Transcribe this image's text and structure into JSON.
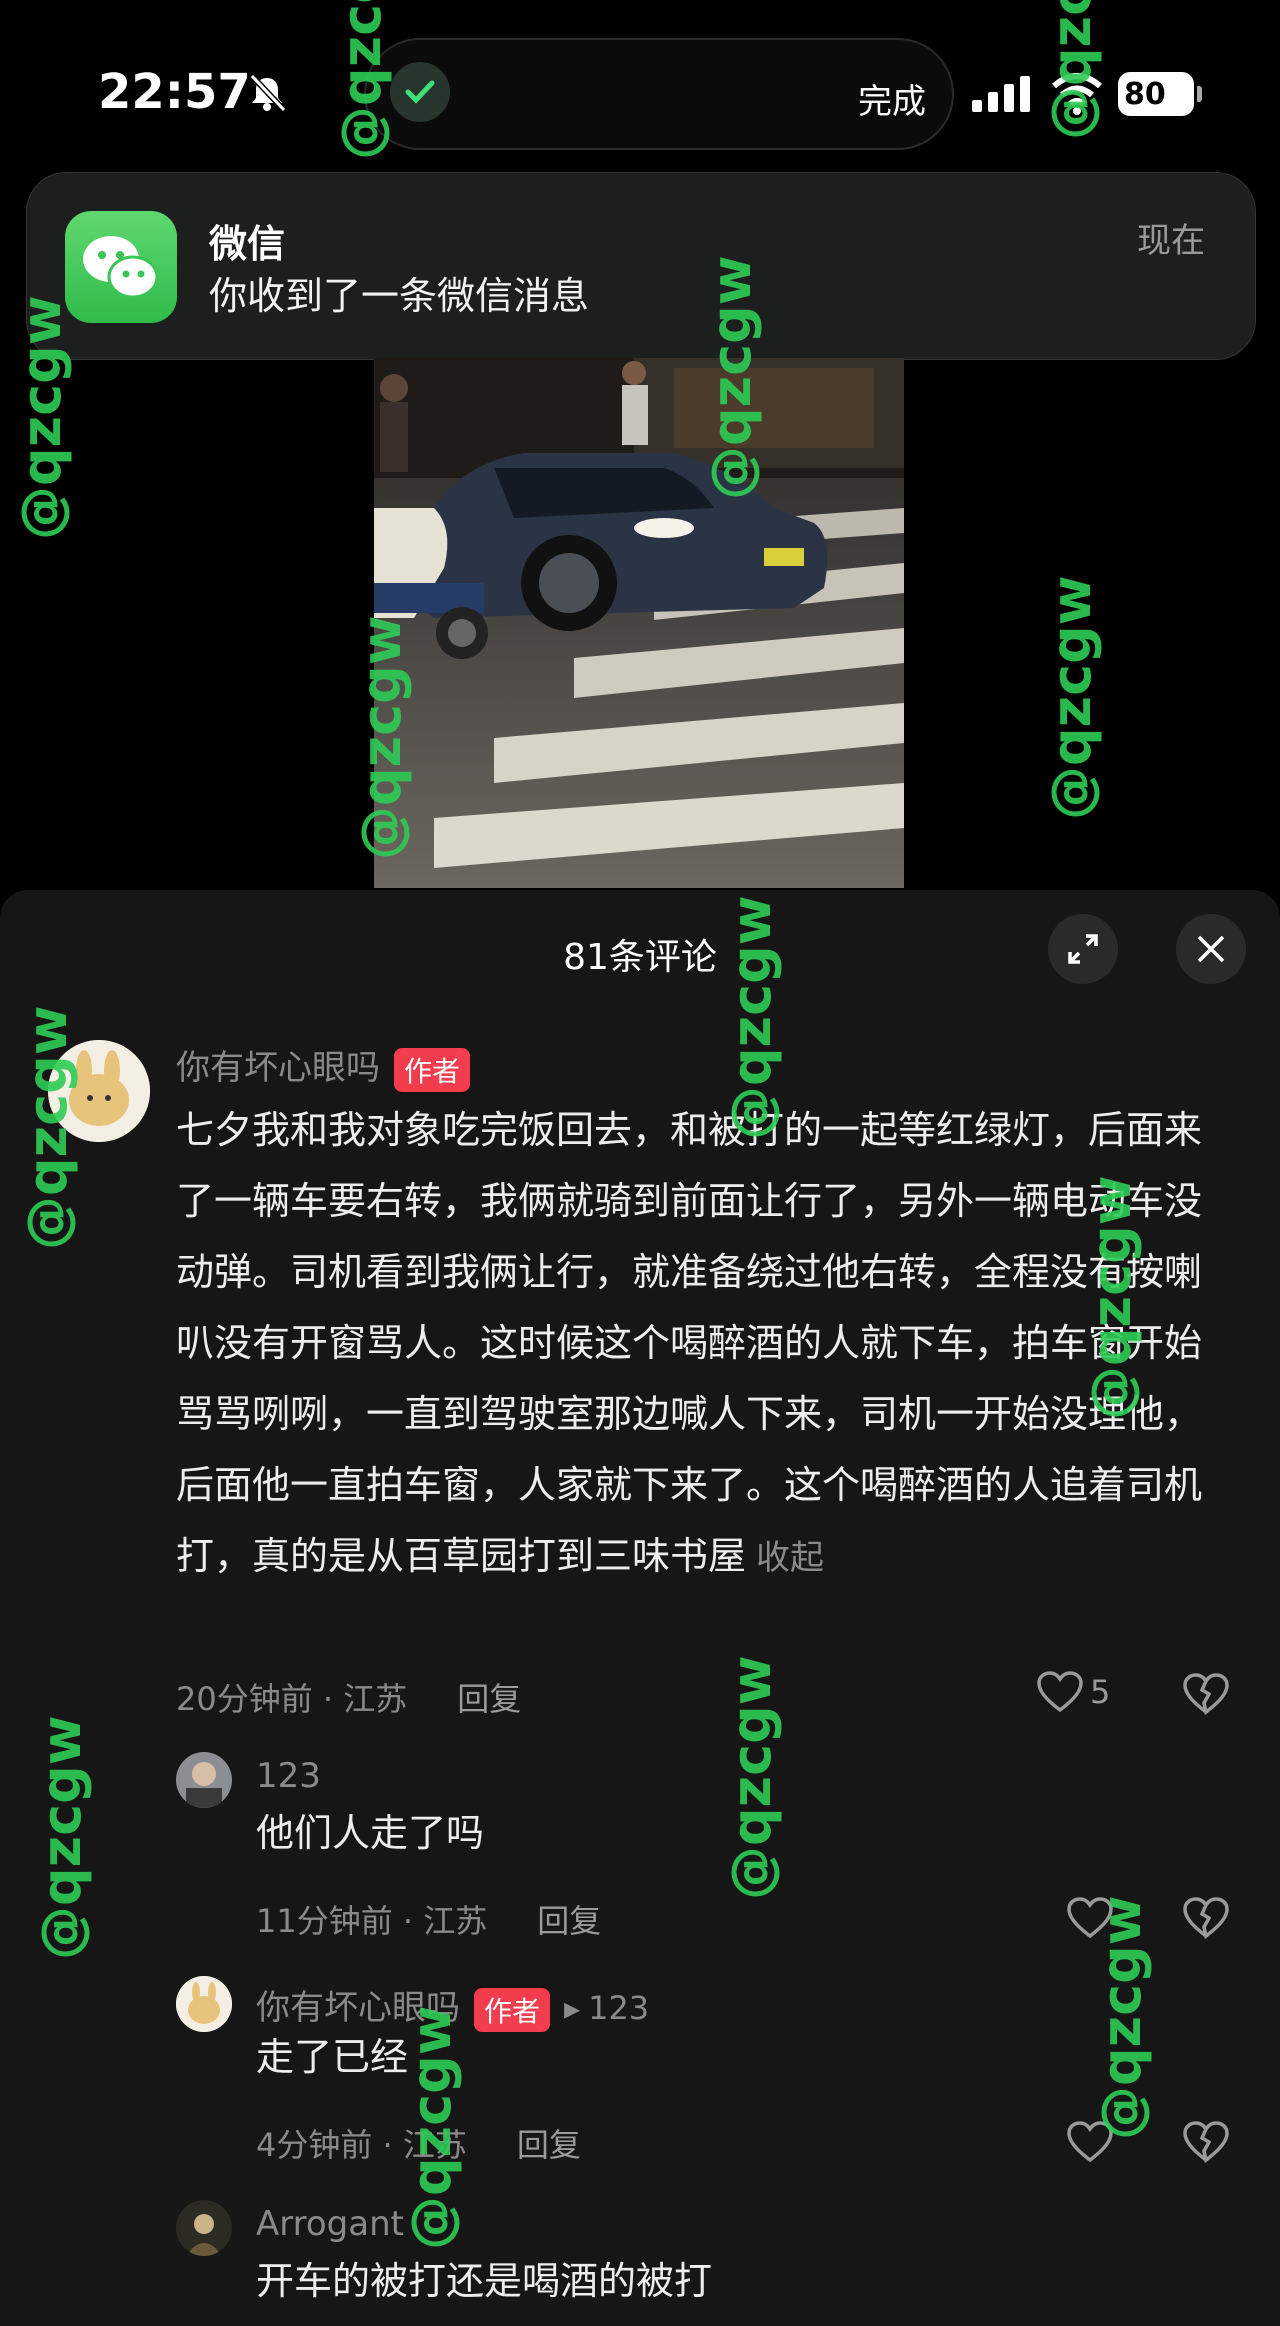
{
  "status_bar": {
    "time": "22:57",
    "island_label": "完成",
    "battery": "80"
  },
  "notification": {
    "app_name": "微信",
    "message": "你收到了一条微信消息",
    "time": "现在"
  },
  "watermark": "@qzcgw",
  "comments": {
    "title": "81条评论",
    "items": [
      {
        "user": "你有坏心眼吗",
        "badge": "作者",
        "text": "七夕我和我对象吃完饭回去，和被打的一起等红绿灯，后面来了一辆车要右转，我俩就骑到前面让行了，另外一辆电动车没动弹。司机看到我俩让行，就准备绕过他右转，全程没有按喇叭没有开窗骂人。这时候这个喝醉酒的人就下车，拍车窗开始骂骂咧咧，一直到驾驶室那边喊人下来，司机一开始没理他，后面他一直拍车窗，人家就下来了。这个喝醉酒的人追着司机打，真的是从百草园打到三味书屋",
        "collapse": "收起",
        "time_loc": "20分钟前 · 江苏",
        "reply": "回复",
        "likes": "5"
      },
      {
        "user": "123",
        "text": "他们人走了吗",
        "time_loc": "11分钟前 · 江苏",
        "reply": "回复"
      },
      {
        "user": "你有坏心眼吗",
        "badge": "作者",
        "reply_to": "123",
        "text": "走了已经",
        "time_loc": "4分钟前 · 江苏",
        "reply": "回复"
      },
      {
        "user": "Arrogant",
        "text": "开车的被打还是喝酒的被打"
      }
    ]
  }
}
